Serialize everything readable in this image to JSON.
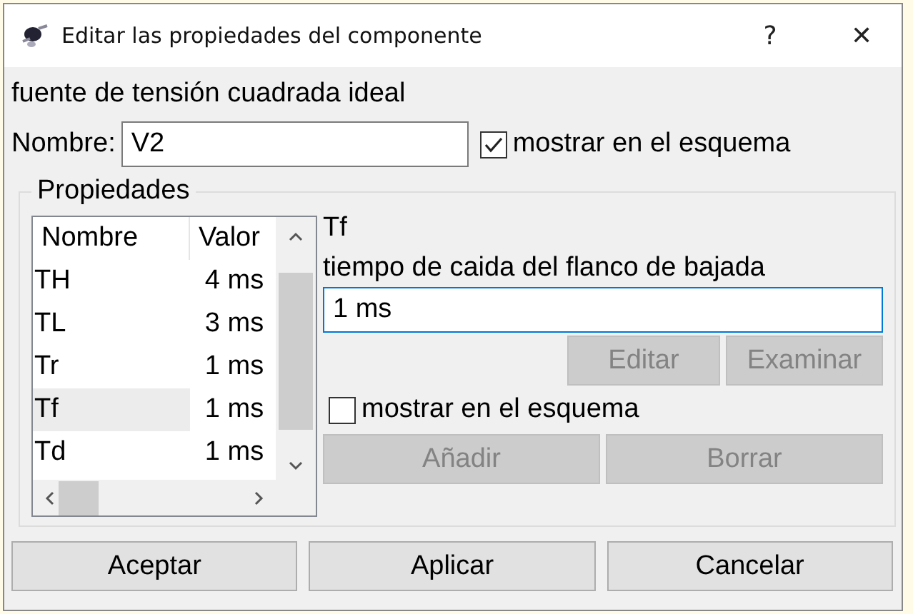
{
  "window": {
    "title": "Editar las propiedades del componente",
    "help": "?",
    "close": "✕"
  },
  "component_type": "fuente de tensión cuadrada ideal",
  "name_field": {
    "label": "Nombre:",
    "value": "V2"
  },
  "show_name": {
    "label": "mostrar en el esquema",
    "checked": true
  },
  "properties": {
    "title": "Propiedades",
    "table": {
      "columns": [
        "Nombre",
        "Valor"
      ],
      "rows": [
        {
          "name": "TH",
          "value": "4 ms",
          "selected": false
        },
        {
          "name": "TL",
          "value": "3 ms",
          "selected": false
        },
        {
          "name": "Tr",
          "value": "1 ms",
          "selected": false
        },
        {
          "name": "Tf",
          "value": "1 ms",
          "selected": true
        },
        {
          "name": "Td",
          "value": "1 ms",
          "selected": false
        }
      ]
    },
    "detail": {
      "name": "Tf",
      "description": "tiempo de caida del flanco de bajada",
      "value": "1 ms"
    },
    "edit_buttons": [
      {
        "label": "Editar",
        "disabled": true
      },
      {
        "label": "Examinar",
        "disabled": true
      }
    ],
    "show_property": {
      "label": "mostrar en el esquema",
      "checked": false
    },
    "list_buttons": [
      {
        "label": "Añadir",
        "disabled": true
      },
      {
        "label": "Borrar",
        "disabled": true
      }
    ]
  },
  "buttons": [
    {
      "label": "Aceptar",
      "disabled": false
    },
    {
      "label": "Aplicar",
      "disabled": false
    },
    {
      "label": "Cancelar",
      "disabled": false
    }
  ]
}
